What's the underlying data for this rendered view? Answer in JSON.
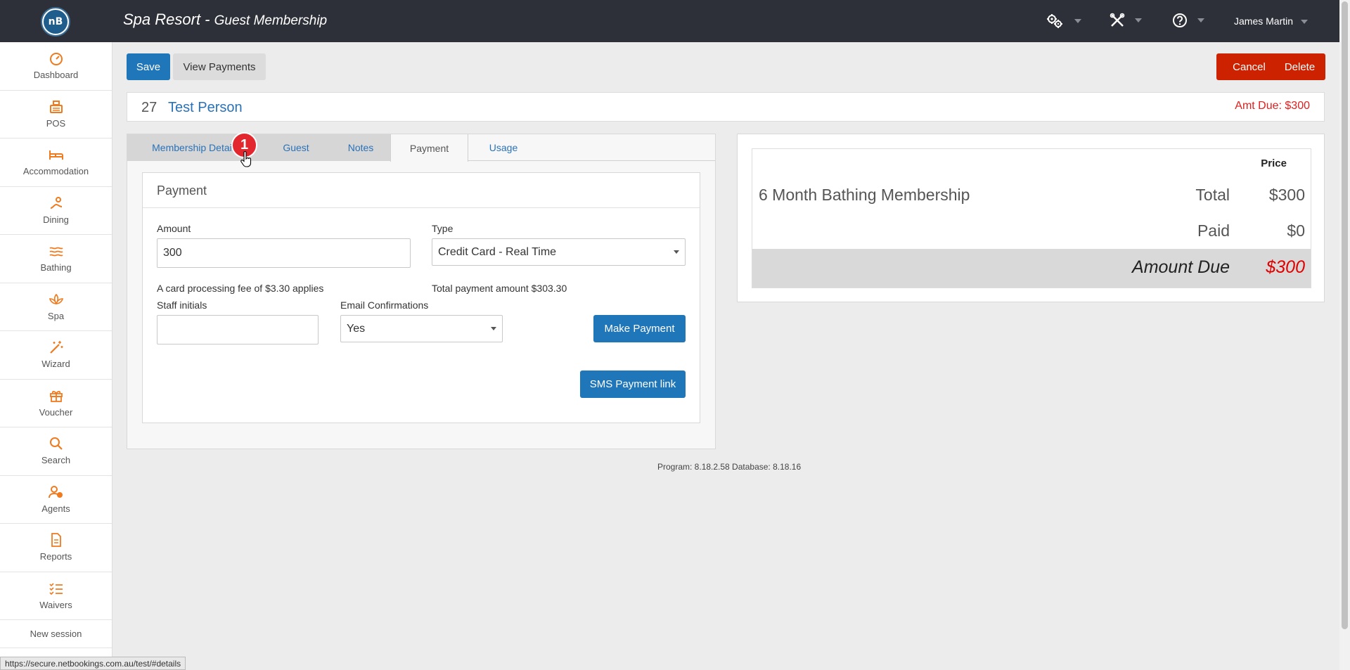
{
  "header": {
    "logo_text": "nB",
    "title": "Spa Resort - ",
    "subtitle": "Guest Membership",
    "user": "James Martin"
  },
  "sidebar": {
    "items": [
      {
        "label": "Dashboard",
        "icon": "dashboard-icon"
      },
      {
        "label": "POS",
        "icon": "cash-register-icon"
      },
      {
        "label": "Accommodation",
        "icon": "bed-icon"
      },
      {
        "label": "Dining",
        "icon": "dining-icon"
      },
      {
        "label": "Bathing",
        "icon": "waves-icon"
      },
      {
        "label": "Spa",
        "icon": "lotus-icon"
      },
      {
        "label": "Wizard",
        "icon": "magic-wand-icon"
      },
      {
        "label": "Voucher",
        "icon": "gift-icon"
      },
      {
        "label": "Search",
        "icon": "search-icon"
      },
      {
        "label": "Agents",
        "icon": "agents-icon"
      },
      {
        "label": "Reports",
        "icon": "document-icon"
      },
      {
        "label": "Waivers",
        "icon": "checklist-icon"
      }
    ],
    "new_session": "New session"
  },
  "toolbar": {
    "save": "Save",
    "view_payments": "View Payments",
    "cancel": "Cancel",
    "delete": "Delete"
  },
  "person": {
    "id": "27",
    "name": "Test Person",
    "amt_due": "Amt Due: $300"
  },
  "tabs": [
    {
      "label": "Membership Details"
    },
    {
      "label": "Guest"
    },
    {
      "label": "Notes"
    },
    {
      "label": "Payment"
    },
    {
      "label": "Usage"
    }
  ],
  "badge": "1",
  "payment": {
    "title": "Payment",
    "amount_label": "Amount",
    "amount_value": "300",
    "type_label": "Type",
    "type_value": "Credit Card - Real Time",
    "fee_note": "A card processing fee of $3.30 applies",
    "total_note": "Total payment amount $303.30",
    "staff_label": "Staff initials",
    "staff_value": "",
    "email_label": "Email Confirmations",
    "email_value": "Yes",
    "make_payment": "Make Payment",
    "sms_link": "SMS Payment link"
  },
  "summary": {
    "price_header": "Price",
    "item": "6 Month Bathing Membership",
    "total_label": "Total",
    "total_value": "$300",
    "paid_label": "Paid",
    "paid_value": "$0",
    "due_label": "Amount Due",
    "due_value": "$300"
  },
  "footer": {
    "version": "Program: 8.18.2.58 Database: 8.18.16"
  },
  "status_url": "https://secure.netbookings.com.au/test/#details",
  "colors": {
    "accent": "#f07a1e",
    "primary": "#1f76b8",
    "danger": "#cc2200",
    "topbar": "#2d3039"
  }
}
